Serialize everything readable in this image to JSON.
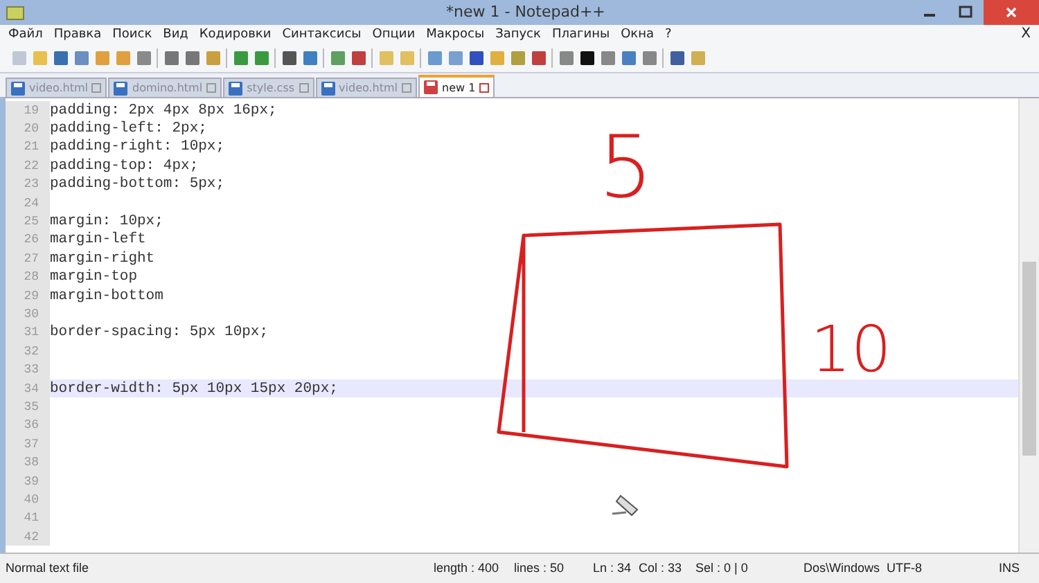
{
  "window": {
    "title": "*new  1 - Notepad++"
  },
  "menu": [
    "Файл",
    "Правка",
    "Поиск",
    "Вид",
    "Кодировки",
    "Синтаксисы",
    "Опции",
    "Макросы",
    "Запуск",
    "Плагины",
    "Окна",
    "?"
  ],
  "menu_close": "X",
  "tabs": [
    {
      "label": "video.html",
      "selected": false,
      "modified": false
    },
    {
      "label": "domino.html",
      "selected": false,
      "modified": false
    },
    {
      "label": "style.css",
      "selected": false,
      "modified": false
    },
    {
      "label": "video.html",
      "selected": false,
      "modified": false
    },
    {
      "label": "new 1",
      "selected": true,
      "modified": true
    }
  ],
  "editor": {
    "lines": [
      {
        "number": "19",
        "text": "padding: 2px 4px 8px 16px;",
        "current": false
      },
      {
        "number": "20",
        "text": "padding-left: 2px;",
        "current": false
      },
      {
        "number": "21",
        "text": "padding-right: 10px;",
        "current": false
      },
      {
        "number": "22",
        "text": "padding-top: 4px;",
        "current": false
      },
      {
        "number": "23",
        "text": "padding-bottom: 5px;",
        "current": false
      },
      {
        "number": "24",
        "current": false
      },
      {
        "number": "25",
        "text": "margin: 10px;",
        "current": false
      },
      {
        "number": "26",
        "text": "margin-left",
        "current": false
      },
      {
        "number": "27",
        "text": "margin-right",
        "current": false
      },
      {
        "number": "28",
        "text": "margin-top",
        "current": false
      },
      {
        "number": "29",
        "text": "margin-bottom",
        "current": false
      },
      {
        "number": "30",
        "current": false
      },
      {
        "number": "31",
        "text": "border-spacing: 5px 10px;",
        "current": false
      },
      {
        "number": "32",
        "current": false
      },
      {
        "number": "33",
        "current": false
      },
      {
        "number": "34",
        "text": "border-width: 5px 10px 15px 20px;",
        "current": true
      },
      {
        "number": "35",
        "current": false
      },
      {
        "number": "36",
        "current": false
      },
      {
        "number": "37",
        "current": false
      },
      {
        "number": "38",
        "current": false
      },
      {
        "number": "39",
        "current": false
      },
      {
        "number": "40",
        "current": false
      },
      {
        "number": "41",
        "current": false
      },
      {
        "number": "42",
        "current": false
      }
    ]
  },
  "annotations": [
    {
      "text": "5",
      "kind": "top"
    },
    {
      "text": "10",
      "kind": "right"
    }
  ],
  "status_bar": {
    "file_type": "Normal text file",
    "length": "length : 400",
    "lines": "lines : 50",
    "ln": "Ln : 34",
    "col": "Col : 33",
    "sel": "Sel : 0 | 0",
    "eol": "Dos\\Windows",
    "encoding": "UTF-8",
    "mode": "INS"
  }
}
